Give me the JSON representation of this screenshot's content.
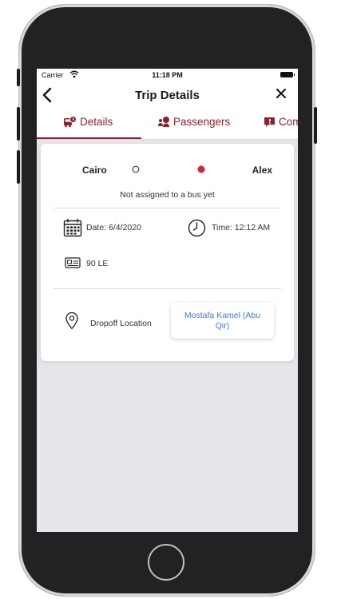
{
  "status_bar": {
    "carrier": "Carrier",
    "time": "11:18 PM"
  },
  "nav": {
    "title": "Trip Details",
    "back_icon": "chevron-left-icon",
    "close_icon": "close-icon"
  },
  "tabs": [
    {
      "label": "Details",
      "icon": "bus-clock-icon",
      "active": true
    },
    {
      "label": "Passengers",
      "icon": "passengers-icon",
      "active": false
    },
    {
      "label": "Com",
      "icon": "comment-icon",
      "active": false
    }
  ],
  "route": {
    "from": "Cairo",
    "to": "Alex"
  },
  "bus_status": "Not assigned to a bus yet",
  "trip": {
    "date": "Date: 6/4/2020",
    "time": "Time: 12:12 AM",
    "price": "90 LE"
  },
  "dropoff": {
    "label": "Dropoff Location",
    "value": "Mostafa Kamel (Abu Qir)"
  },
  "colors": {
    "accent": "#8a2130",
    "link": "#3a7bd5",
    "route_dot": "#d4213d",
    "route_line_start": "#2e2a5e"
  }
}
